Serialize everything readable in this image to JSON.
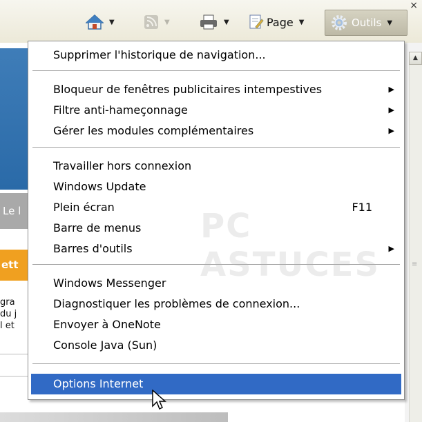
{
  "toolbar": {
    "home_icon": "home-icon",
    "feeds_icon": "rss-feed-icon",
    "print_icon": "printer-icon",
    "page_icon": "page-icon",
    "page_label": "Page",
    "tools_icon": "gear-icon",
    "tools_label": "Outils"
  },
  "background": {
    "grey_band_text": "Le l",
    "orange_band_text": "ett",
    "snippet_lines": [
      "gra",
      "du j",
      "l et"
    ]
  },
  "menu": {
    "items": [
      {
        "label": "Supprimer l'historique de navigation..."
      },
      {
        "label": "Bloqueur de fenêtres publicitaires intempestives",
        "submenu": true
      },
      {
        "label": "Filtre anti-hameçonnage",
        "submenu": true
      },
      {
        "label": "Gérer les modules complémentaires",
        "submenu": true
      },
      {
        "label": "Travailler hors connexion"
      },
      {
        "label": "Windows Update"
      },
      {
        "label": "Plein écran",
        "shortcut": "F11"
      },
      {
        "label": "Barre de menus"
      },
      {
        "label": "Barres d'outils",
        "submenu": true
      },
      {
        "label": "Windows Messenger"
      },
      {
        "label": "Diagnostiquer les problèmes de connexion..."
      },
      {
        "label": "Envoyer à OneNote"
      },
      {
        "label": "Console Java (Sun)"
      },
      {
        "label": "Options Internet",
        "highlighted": true
      }
    ]
  },
  "watermark": "PC ASTUCES",
  "colors": {
    "menu_highlight": "#316ac5",
    "toolbar_bg": "#ece9d8"
  }
}
